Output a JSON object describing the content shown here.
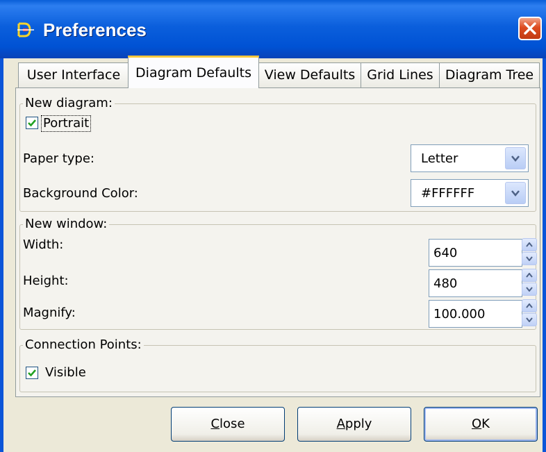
{
  "window": {
    "title": "Preferences",
    "app_icon": "diagram-app-icon",
    "close_icon": "close-icon",
    "accent_color": "#0b5fdc",
    "close_color": "#dd4b1f"
  },
  "tabs": [
    {
      "label": "User Interface",
      "active": false
    },
    {
      "label": "Diagram Defaults",
      "active": true
    },
    {
      "label": "View Defaults",
      "active": false
    },
    {
      "label": "Grid Lines",
      "active": false
    },
    {
      "label": "Diagram Tree",
      "active": false
    }
  ],
  "new_diagram": {
    "legend": "New diagram:",
    "portrait_label": "Portrait",
    "portrait_checked": true,
    "paper_type_label": "Paper type:",
    "paper_type_value": "Letter",
    "background_color_label": "Background Color:",
    "background_color_value": "#FFFFFF"
  },
  "new_window": {
    "legend": "New window:",
    "width_label": "Width:",
    "width_value": "640",
    "height_label": "Height:",
    "height_value": "480",
    "magnify_label": "Magnify:",
    "magnify_value": "100.000"
  },
  "connection_points": {
    "legend": "Connection Points:",
    "visible_label": "Visible",
    "visible_checked": true
  },
  "buttons": {
    "close_mnemonic": "C",
    "close_rest": "lose",
    "apply_mnemonic": "A",
    "apply_rest": "pply",
    "ok_mnemonic": "O",
    "ok_rest": "K"
  }
}
